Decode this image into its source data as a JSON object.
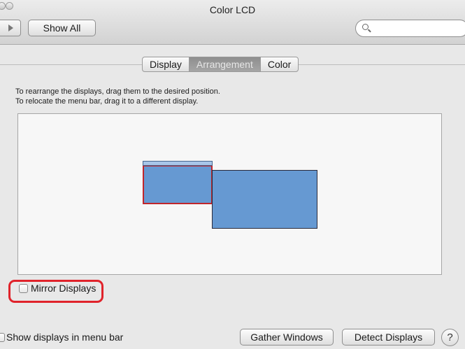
{
  "window": {
    "title": "Color LCD"
  },
  "toolbar": {
    "show_all_label": "Show All",
    "search_placeholder": ""
  },
  "tabs": [
    {
      "label": "Display",
      "active": false
    },
    {
      "label": "Arrangement",
      "active": true
    },
    {
      "label": "Color",
      "active": false
    }
  ],
  "arrangement": {
    "instruction_1": "To rearrange the displays, drag them to the desired position.",
    "instruction_2": "To relocate the menu bar, drag it to a different display.",
    "display_color": "#6699d2",
    "selected_outline_color": "#c0262c"
  },
  "mirror": {
    "label": "Mirror Displays",
    "checked": false,
    "highlight_color": "#e0232b"
  },
  "footer": {
    "show_in_menu_bar_label": "Show displays in menu bar",
    "show_in_menu_bar_checked": false,
    "gather_label": "Gather Windows",
    "detect_label": "Detect Displays",
    "help_glyph": "?"
  }
}
